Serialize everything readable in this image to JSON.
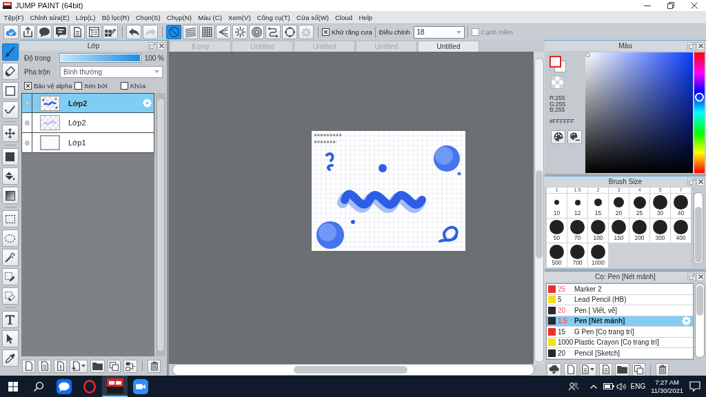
{
  "window": {
    "title": "JUMP PAINT (64bit)"
  },
  "menu": [
    "Tệp(F)",
    "Chỉnh sửa(E)",
    "Lớp(L)",
    "Bộ lọc(R)",
    "Chọn(S)",
    "Chụp(N)",
    "Màu (C)",
    "Xem(V)",
    "Công cụ(T)",
    "Cửa sổ(W)",
    "Cloud",
    "Help"
  ],
  "toolbar": {
    "buttons": [
      {
        "selected": false,
        "disabled": false
      },
      {
        "selected": false,
        "disabled": false
      },
      {
        "selected": false,
        "disabled": false
      },
      {
        "selected": false,
        "disabled": false
      },
      {
        "selected": false,
        "disabled": false
      },
      {
        "selected": false,
        "disabled": false
      },
      {
        "selected": false,
        "disabled": false
      },
      {
        "selected": false,
        "disabled": false
      },
      {
        "selected": false,
        "disabled": true
      },
      {
        "selected": true,
        "disabled": false
      },
      {
        "selected": false,
        "disabled": false
      },
      {
        "selected": false,
        "disabled": false
      },
      {
        "selected": false,
        "disabled": false
      },
      {
        "selected": false,
        "disabled": false
      },
      {
        "selected": false,
        "disabled": false
      },
      {
        "selected": false,
        "disabled": false
      },
      {
        "selected": false,
        "disabled": false
      },
      {
        "selected": false,
        "disabled": true
      }
    ],
    "antialias": {
      "label": "Khử răng cưa",
      "checked": true
    },
    "adjust": {
      "label": "Điều chỉnh",
      "value": "18"
    },
    "soft_edge": {
      "label": "Cạnh mềm",
      "checked": false,
      "disabled": true
    }
  },
  "tools": [
    {
      "selected": true
    },
    {
      "selected": false
    },
    {
      "selected": false
    },
    {
      "selected": false
    },
    {
      "selected": false
    },
    {
      "selected": false
    },
    {
      "selected": false
    },
    {
      "selected": false
    },
    {
      "selected": false
    },
    {
      "selected": false
    },
    {
      "selected": false
    },
    {
      "selected": false
    },
    {
      "selected": false
    },
    {
      "selected": false
    },
    {
      "selected": false
    },
    {
      "selected": false
    }
  ],
  "layer_panel": {
    "title": "Lớp",
    "opacity": {
      "label": "Độ trong",
      "level": 1,
      "reading": "100 %"
    },
    "blend": {
      "label": "Pha trộn",
      "value": "Bình thường"
    },
    "options": [
      {
        "label": "Bảo vệ alpha",
        "checked": true
      },
      {
        "label": "Xén bớt",
        "checked": false
      },
      {
        "label": "Khóa",
        "checked": false
      }
    ],
    "layers": [
      {
        "name": "Lớp2",
        "kind": "art",
        "selected": true
      },
      {
        "name": "Lớp2",
        "kind": "faint",
        "selected": false
      },
      {
        "name": "Lớp1",
        "kind": "blank",
        "selected": false
      }
    ]
  },
  "document_tabs": [
    {
      "label": "8.png",
      "selected": false
    },
    {
      "label": "Untitled",
      "selected": false
    },
    {
      "label": "Untitled",
      "selected": false
    },
    {
      "label": "Untitled",
      "selected": false
    },
    {
      "label": "Untitled",
      "selected": true
    }
  ],
  "color_panel": {
    "title": "Màu",
    "rgb": [
      "R:255",
      "G:255",
      "B:255"
    ],
    "hex": "#FFFFFF",
    "hue": {
      "level": 0.63
    }
  },
  "brush_size_panel": {
    "title": "Brush Size",
    "top_labels": [
      "1",
      "1.5",
      "2",
      "3",
      "4",
      "5",
      "7"
    ],
    "sizes": [
      "10",
      "12",
      "15",
      "20",
      "25",
      "30",
      "40",
      "50",
      "70",
      "100",
      "150",
      "200",
      "300",
      "400",
      "500",
      "700",
      "1000"
    ]
  },
  "brush_panel": {
    "title": "Cọ: Pen [Nét mảnh]",
    "brushes": [
      {
        "size": "25",
        "name": "Marker 2",
        "color": "#e8322e",
        "size_highlighted": true,
        "selected": false
      },
      {
        "size": "5",
        "name": "Lead Pencil (HB)",
        "color": "#f2e01c",
        "size_highlighted": false,
        "selected": false
      },
      {
        "size": "20",
        "name": "Pen [ Viết, vẽ]",
        "color": "#2a2a2e",
        "size_highlighted": true,
        "selected": false
      },
      {
        "size": "1.5",
        "name": "Pen [Nét mảnh]",
        "color": "#2a2a2e",
        "size_highlighted": true,
        "selected": true
      },
      {
        "size": "15",
        "name": "G Pen [Cọ trang trí]",
        "color": "#e8322e",
        "size_highlighted": false,
        "selected": false
      },
      {
        "size": "1000",
        "name": "Plastic Crayon [Cọ trang trí]",
        "color": "#f2e01c",
        "size_highlighted": false,
        "selected": false
      },
      {
        "size": "20",
        "name": "Pencil [Sketch]",
        "color": "#2a2a2e",
        "size_highlighted": false,
        "selected": false
      }
    ]
  },
  "taskbar": {
    "apps": [
      {
        "selected": false
      },
      {
        "selected": false
      },
      {
        "selected": true
      },
      {
        "selected": false
      }
    ],
    "language": "ENG",
    "time": "7:27 AM",
    "date": "11/30/2021"
  }
}
